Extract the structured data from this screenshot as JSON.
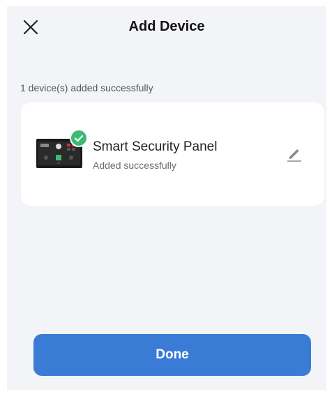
{
  "header": {
    "title": "Add Device",
    "close_icon": "close-icon"
  },
  "status": {
    "message": "1 device(s) added successfully"
  },
  "device": {
    "name": "Smart Security Panel",
    "subtitle": "Added successfully",
    "thumbnail_icon": "security-panel-thumbnail",
    "badge_icon": "check-icon",
    "edit_icon": "pencil-icon",
    "badge_color": "#3dbb73"
  },
  "footer": {
    "done_label": "Done",
    "accent_color": "#3a7bd5"
  }
}
